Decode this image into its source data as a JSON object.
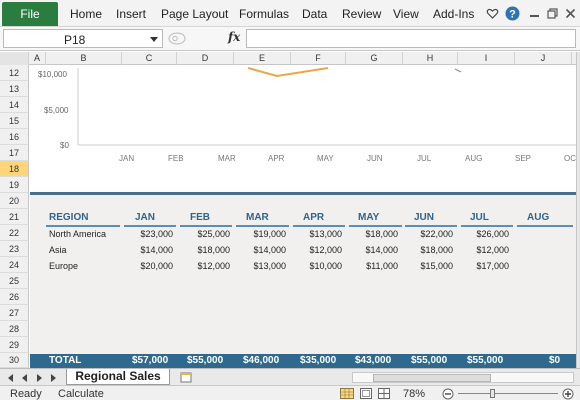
{
  "ribbon": {
    "file": "File",
    "tabs": [
      "Home",
      "Insert",
      "Page Layout",
      "Formulas",
      "Data",
      "Review",
      "View",
      "Add-Ins"
    ]
  },
  "formula_bar": {
    "name_box": "P18",
    "fx": "fx",
    "formula": ""
  },
  "columns": [
    "A",
    "B",
    "C",
    "D",
    "E",
    "F",
    "G",
    "H",
    "I",
    "J"
  ],
  "rows": [
    "12",
    "13",
    "14",
    "15",
    "16",
    "17",
    "18",
    "19",
    "20",
    "21",
    "22",
    "23",
    "24",
    "25",
    "26",
    "27",
    "28",
    "29",
    "30"
  ],
  "selected_row": "18",
  "chart": {
    "y_ticks": [
      "$10,000",
      "$5,000",
      "$0"
    ],
    "x_ticks": [
      "JAN",
      "FEB",
      "MAR",
      "APR",
      "MAY",
      "JUN",
      "JUL",
      "AUG",
      "SEP",
      "OC"
    ],
    "line_color": "#e8a84a"
  },
  "table": {
    "headers": [
      "REGION",
      "JAN",
      "FEB",
      "MAR",
      "APR",
      "MAY",
      "JUN",
      "JUL",
      "AUG"
    ],
    "rows": [
      {
        "region": "North America",
        "values": [
          "$23,000",
          "$25,000",
          "$19,000",
          "$13,000",
          "$18,000",
          "$22,000",
          "$26,000"
        ]
      },
      {
        "region": "Asia",
        "values": [
          "$14,000",
          "$18,000",
          "$14,000",
          "$12,000",
          "$14,000",
          "$18,000",
          "$12,000"
        ]
      },
      {
        "region": "Europe",
        "values": [
          "$20,000",
          "$12,000",
          "$13,000",
          "$10,000",
          "$11,000",
          "$15,000",
          "$17,000"
        ]
      }
    ],
    "total": {
      "label": "TOTAL",
      "values": [
        "$57,000",
        "$55,000",
        "$46,000",
        "$35,000",
        "$43,000",
        "$55,000",
        "$55,000",
        "$0"
      ]
    }
  },
  "sheet_tabs": {
    "active": "Regional Sales"
  },
  "status": {
    "ready": "Ready",
    "calculate": "Calculate",
    "zoom": "78%"
  },
  "colors": {
    "file_tab": "#2a7c3f",
    "header_text": "#31648a",
    "total_bar": "#2f6a8e",
    "chart_frame": "#4a6f86"
  }
}
